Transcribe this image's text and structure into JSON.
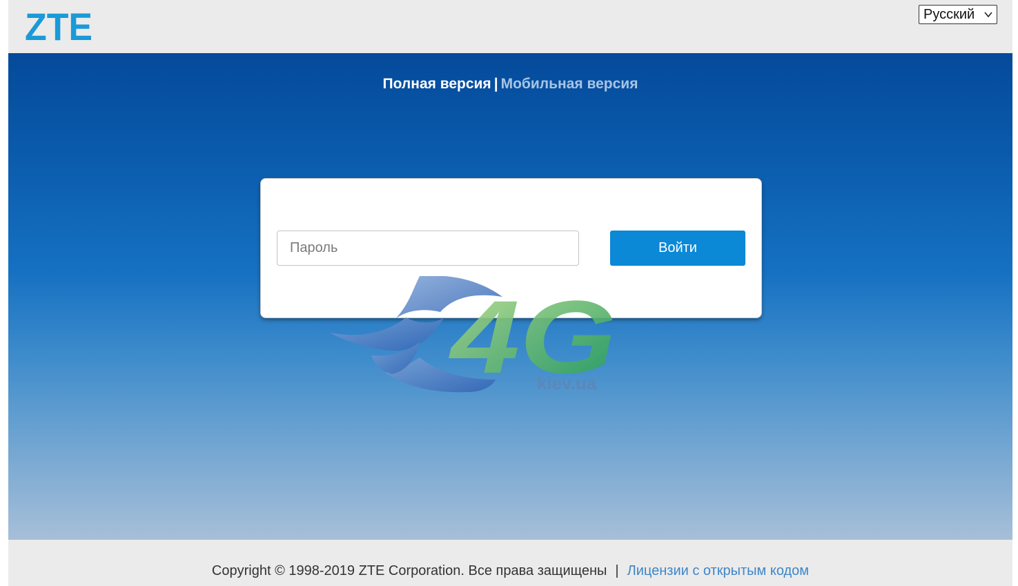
{
  "header": {
    "logo_text": "ZTE",
    "language": {
      "selected": "Русский"
    }
  },
  "hero": {
    "version_switch": {
      "full": "Полная версия",
      "separator": "|",
      "mobile": "Мобильная версия"
    },
    "login": {
      "password_placeholder": "Пароль",
      "login_label": "Войти"
    },
    "watermark": {
      "brand": "4G",
      "domain": "kiev.ua"
    }
  },
  "footer": {
    "copyright": "Copyright © 1998-2019 ZTE Corporation. Все права защищены",
    "separator": "|",
    "license_link": "Лицензии с открытым кодом"
  },
  "colors": {
    "brand_blue": "#1a9ad8",
    "button_blue": "#0b88d6",
    "link_blue": "#3e86c8",
    "watermark_green": "#5fae3f"
  }
}
